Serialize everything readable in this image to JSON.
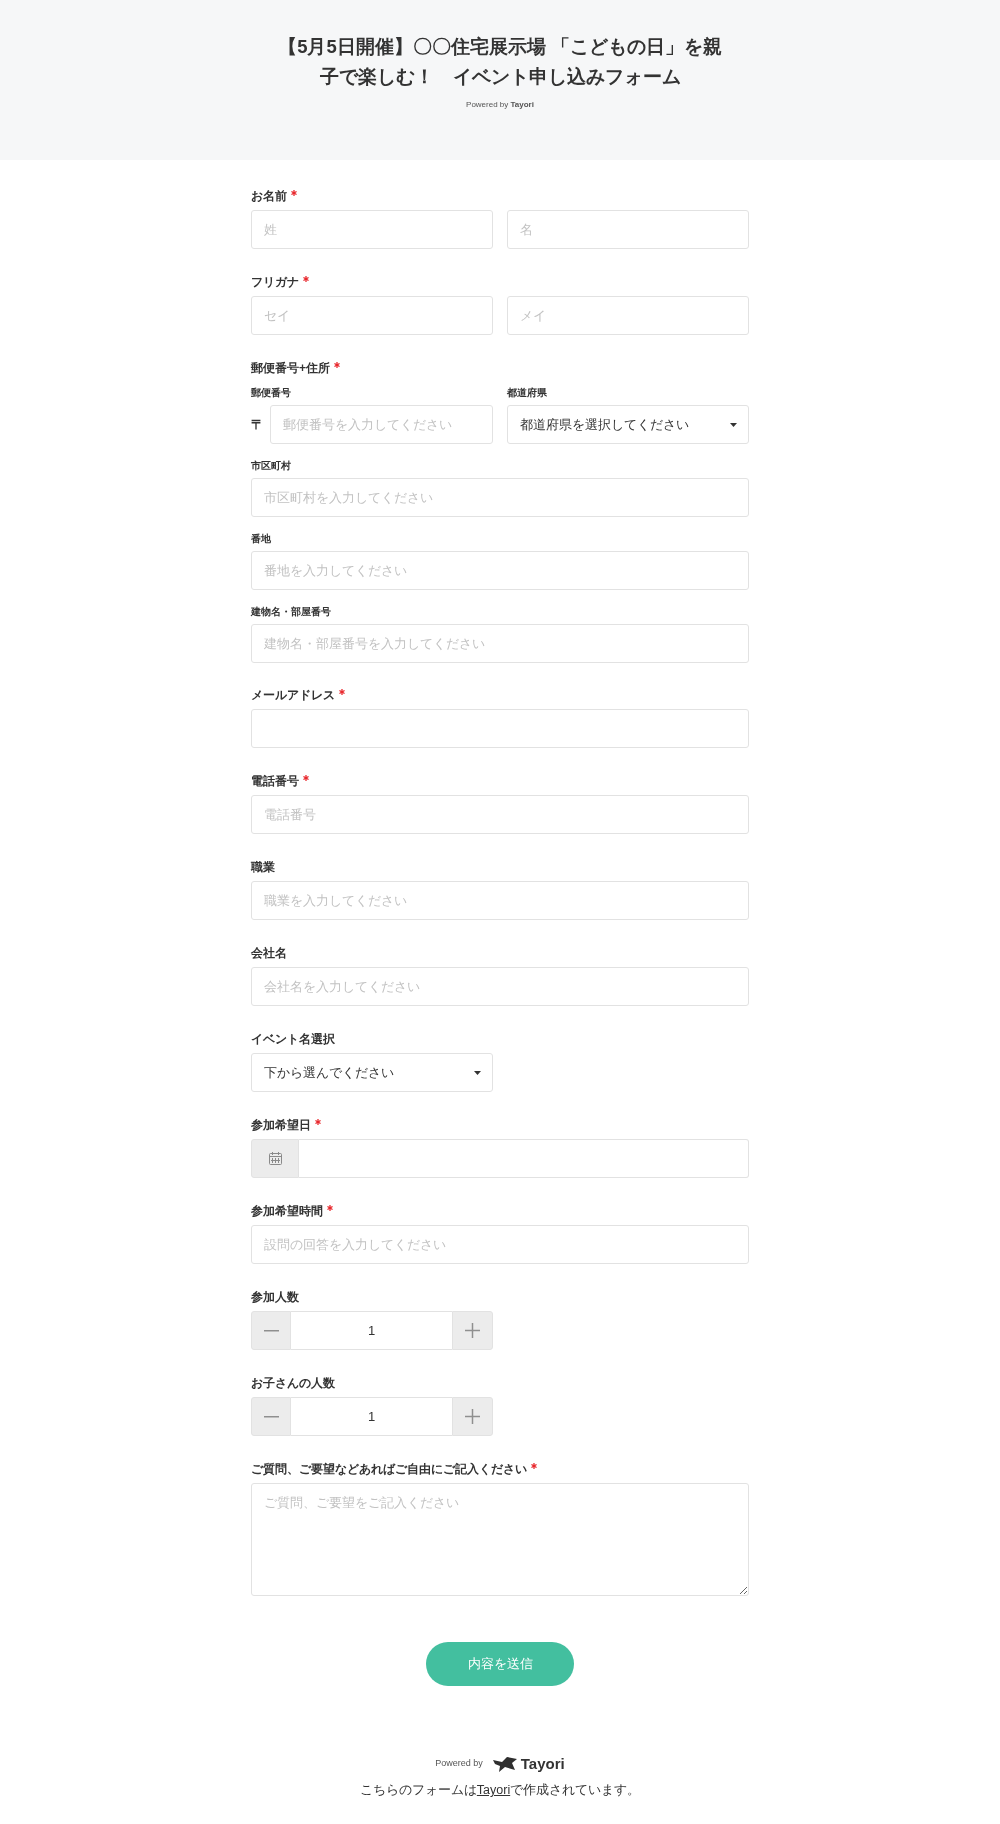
{
  "header": {
    "title": "【5月5日開催】〇〇住宅展示場 「こどもの日」を親子で楽しむ！　イベント申し込みフォーム",
    "powered_by": "Powered by **Tayori**"
  },
  "fields": [
    {
      "kind": "pair",
      "label": "お名前",
      "required": true,
      "inputs": [
        {
          "placeholder": "姓"
        },
        {
          "placeholder": "名"
        }
      ]
    },
    {
      "kind": "pair",
      "label": "フリガナ",
      "required": true,
      "inputs": [
        {
          "placeholder": "セイ"
        },
        {
          "placeholder": "メイ"
        }
      ]
    },
    {
      "kind": "address",
      "label": "郵便番号+住所",
      "required": true,
      "postal": {
        "label": "郵便番号",
        "prefix": "〒",
        "placeholder": "郵便番号を入力してください"
      },
      "prefecture": {
        "label": "都道府県",
        "value": "都道府県を選択してください"
      },
      "lines": [
        {
          "label": "市区町村",
          "placeholder": "市区町村を入力してください"
        },
        {
          "label": "番地",
          "placeholder": "番地を入力してください"
        },
        {
          "label": "建物名・部屋番号",
          "placeholder": "建物名・部屋番号を入力してください"
        }
      ]
    },
    {
      "kind": "text",
      "label": "メールアドレス",
      "required": true
    },
    {
      "kind": "text",
      "label": "電話番号",
      "required": true,
      "placeholder": "電話番号"
    },
    {
      "kind": "text",
      "label": "職業",
      "required": false,
      "placeholder": "職業を入力してください"
    },
    {
      "kind": "text",
      "label": "会社名",
      "required": false,
      "placeholder": "会社名を入力してください"
    },
    {
      "kind": "select",
      "label": "イベント名選択",
      "required": false,
      "value": "下から選んでください"
    },
    {
      "kind": "date",
      "label": "参加希望日",
      "required": true
    },
    {
      "kind": "text",
      "label": "参加希望時間",
      "required": true,
      "placeholder": "設問の回答を入力してください"
    },
    {
      "kind": "stepper",
      "label": "参加人数",
      "required": false,
      "value": "1"
    },
    {
      "kind": "stepper",
      "label": "お子さんの人数",
      "required": false,
      "value": "1"
    },
    {
      "kind": "textarea",
      "label": "ご質問、ご要望などあればご自由にご記入ください",
      "required": true,
      "placeholder": "ご質問、ご要望をご記入ください"
    }
  ],
  "submit": "内容を送信",
  "footer": {
    "powered_by": "Powered by",
    "brand": "Tayori",
    "credit": {
      "before": "こちらのフォームは",
      "link": "Tayori",
      "after": "で作成されています。"
    }
  }
}
